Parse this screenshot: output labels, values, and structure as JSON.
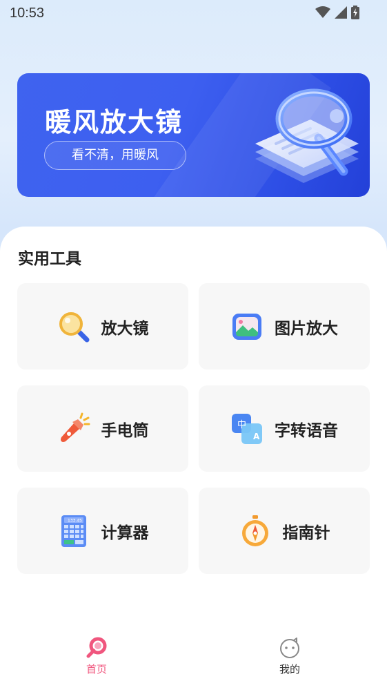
{
  "status_bar": {
    "time": "10:53"
  },
  "banner": {
    "title": "暖风放大镜",
    "subtitle": "看不清，用暖风"
  },
  "section": {
    "title": "实用工具"
  },
  "tools": [
    {
      "label": "放大镜",
      "icon": "magnifier-icon"
    },
    {
      "label": "图片放大",
      "icon": "image-zoom-icon"
    },
    {
      "label": "手电筒",
      "icon": "flashlight-icon"
    },
    {
      "label": "字转语音",
      "icon": "text-to-speech-icon"
    },
    {
      "label": "计算器",
      "icon": "calculator-icon"
    },
    {
      "label": "指南针",
      "icon": "compass-icon"
    }
  ],
  "calculator_display": "133.45",
  "tts_badges": {
    "left": "中",
    "right": "A"
  },
  "tabbar": {
    "home_label": "首页",
    "mine_label": "我的",
    "active_color": "#f0567e",
    "inactive_color": "#333333"
  }
}
